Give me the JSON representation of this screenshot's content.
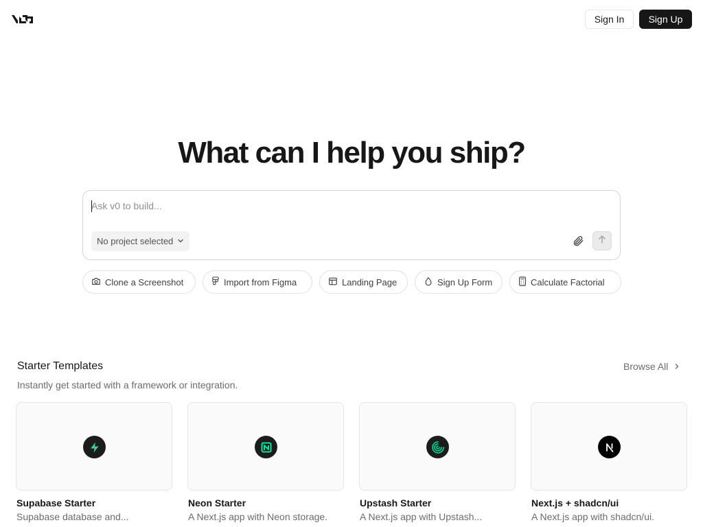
{
  "header": {
    "logo_icon": "v0-logo-icon",
    "sign_in_label": "Sign In",
    "sign_up_label": "Sign Up"
  },
  "hero": {
    "title": "What can I help you ship?"
  },
  "prompt": {
    "placeholder": "Ask v0 to build...",
    "value": "",
    "project_select_label": "No project selected",
    "project_select_icon": "chevron-down-icon",
    "attach_icon": "paperclip-icon",
    "send_icon": "arrow-up-icon"
  },
  "suggestions": [
    {
      "label": "Clone a Screenshot",
      "icon": "camera-icon"
    },
    {
      "label": "Import from Figma",
      "icon": "figma-icon"
    },
    {
      "label": "Landing Page",
      "icon": "layout-icon"
    },
    {
      "label": "Sign Up Form",
      "icon": "droplet-icon"
    },
    {
      "label": "Calculate Factorial",
      "icon": "calculator-icon"
    }
  ],
  "templates": {
    "title": "Starter Templates",
    "subtitle": "Instantly get started with a framework or integration.",
    "browse_all_label": "Browse All",
    "browse_all_icon": "chevron-right-icon",
    "items": [
      {
        "title": "Supabase Starter",
        "description": "Supabase database and...",
        "icon": "supabase-icon",
        "accent": "#3ecf8e"
      },
      {
        "title": "Neon Starter",
        "description": "A Next.js app with Neon storage.",
        "icon": "neon-icon",
        "accent": "#00e599"
      },
      {
        "title": "Upstash Starter",
        "description": "A Next.js app with Upstash...",
        "icon": "upstash-icon",
        "accent": "#00c98d"
      },
      {
        "title": "Next.js + shadcn/ui",
        "description": "A Next.js app with shadcn/ui.",
        "icon": "nextjs-icon",
        "accent": "#ffffff"
      }
    ]
  },
  "colors": {
    "text": "#171717",
    "muted": "#6b6b6b",
    "border": "#e5e5e5",
    "primary_button": "#171717"
  }
}
